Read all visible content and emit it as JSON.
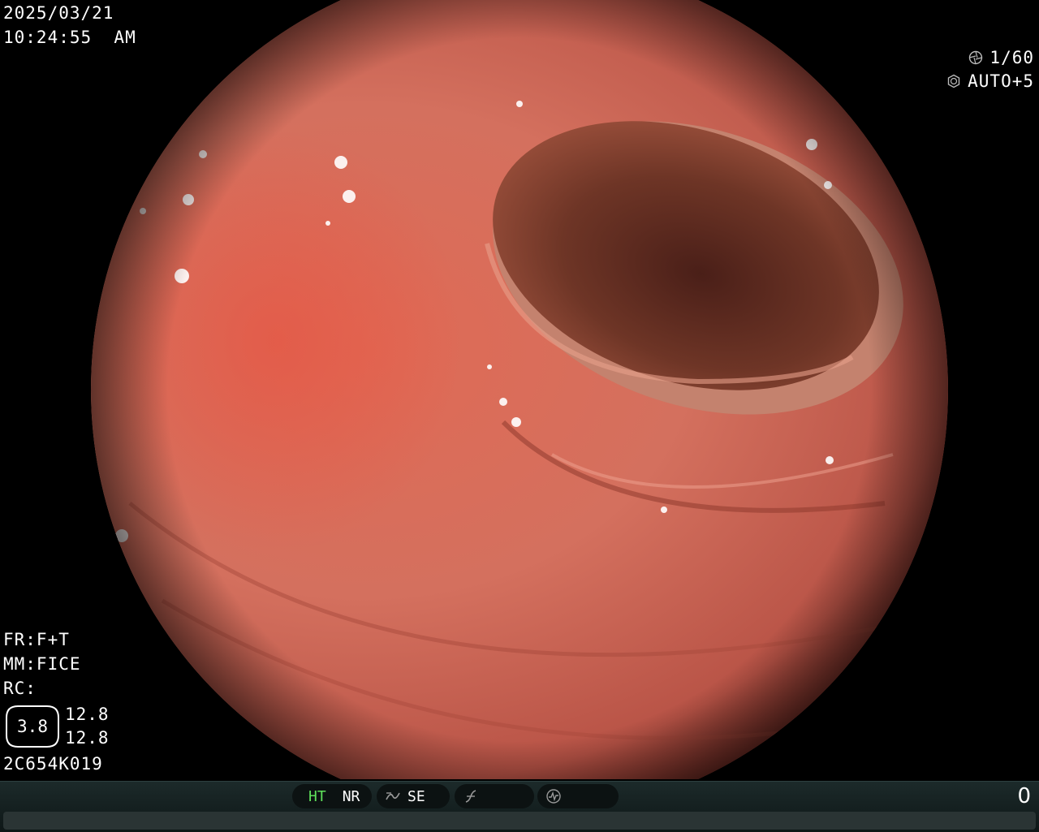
{
  "overlay": {
    "date": "2025/03/21",
    "time": "10:24:55  AM",
    "shutter": "1/60",
    "exposure": "AUTO+5",
    "shutter_icon": "aperture-icon",
    "exposure_icon": "iris-icon",
    "fr": "FR:F+T",
    "mm": "MM:FICE",
    "rc": "RC:",
    "hex_value": "3.8",
    "value_1": "12.8",
    "value_2": "12.8",
    "serial": "2C654K019"
  },
  "statusbar": {
    "ht_label": "HT",
    "nr_label": "NR",
    "se_label": "SE",
    "curve_icon": "tone-curve-icon",
    "sharpness_icon": "sharpness-icon",
    "waveform_icon": "waveform-icon",
    "counter": "0",
    "ht_color": "#5ee05a"
  },
  "view": {
    "subject": "endoscopic colon lumen"
  }
}
